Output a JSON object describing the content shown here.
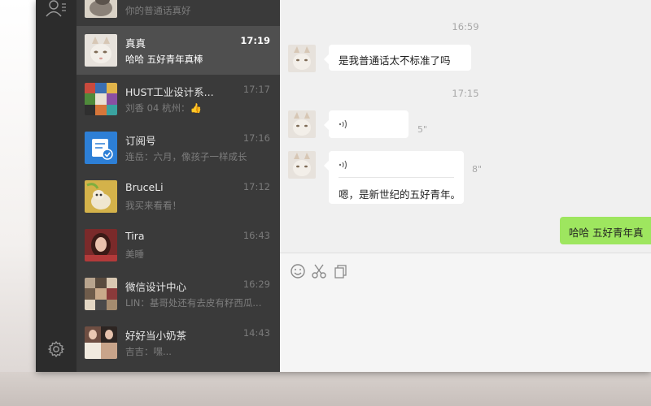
{
  "chat_list": [
    {
      "name": "",
      "time": "",
      "preview": "你的普通话真好",
      "avatar": "cat-photo",
      "active": false
    },
    {
      "name": "真真",
      "time": "17:19",
      "preview": "哈哈 五好青年真棒",
      "avatar": "cat-photo",
      "active": true
    },
    {
      "name": "HUST工业设计系...",
      "time": "17:17",
      "preview": "刘香 04 杭州：",
      "preview_icon": "thumbs-up-icon",
      "avatar": "group-photo-collage",
      "active": false
    },
    {
      "name": "订阅号",
      "time": "17:16",
      "preview": "连岳：六月，像孩子一样成长",
      "avatar": "subscription-icon",
      "active": false
    },
    {
      "name": "BruceLi",
      "time": "17:12",
      "preview": "我买来看看！",
      "avatar": "dog-photo",
      "active": false
    },
    {
      "name": "Tira",
      "time": "16:43",
      "preview": "美睡",
      "avatar": "portrait-photo",
      "active": false
    },
    {
      "name": "微信设计中心",
      "time": "16:29",
      "preview": "LIN：基哥处还有去皮有籽西瓜...",
      "avatar": "group-photo-collage",
      "active": false
    },
    {
      "name": "好好当小奶茶",
      "time": "14:43",
      "preview": "吉吉：嘿...",
      "avatar": "group-photo-collage",
      "active": false
    }
  ],
  "conversation": {
    "timestamps": [
      "16:59",
      "17:15"
    ],
    "messages": [
      {
        "type": "text",
        "text": "是我普通话太不标准了吗",
        "from": "contact"
      },
      {
        "type": "voice",
        "duration": "5\"",
        "from": "contact"
      },
      {
        "type": "voice-transcribed",
        "duration": "8\"",
        "text": "嗯，是新世纪的五好青年。",
        "from": "contact"
      },
      {
        "type": "text",
        "text": "哈哈 五好青年真",
        "from": "me"
      }
    ]
  },
  "toolbar": {
    "icons": [
      "emoji-icon",
      "screenshot-scissors-icon",
      "file-icon"
    ]
  },
  "colors": {
    "rail_bg": "#2c2c2c",
    "list_bg": "#3a3a3a",
    "list_active": "#4f4f4f",
    "my_bubble": "#9ee65f",
    "conv_bg": "#f0f0f0"
  }
}
